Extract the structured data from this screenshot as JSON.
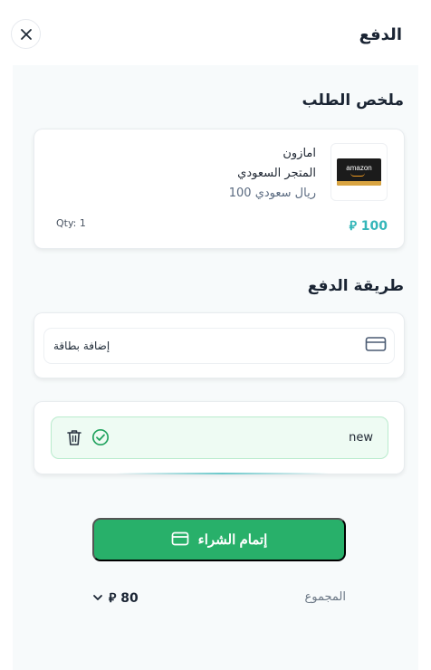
{
  "header": {
    "title": "الدفع"
  },
  "order_summary": {
    "title": "ملخص الطلب",
    "item": {
      "brand": "امازون",
      "store": "المتجر السعودي",
      "denomination": "ريال سعودي 100",
      "thumbnail_text": "amazon",
      "quantity": "Qty: 1",
      "price": "100 ⃁"
    }
  },
  "payment_method": {
    "title": "طريقة الدفع",
    "add_card_label": "إضافة بطاقة",
    "saved_method": {
      "name": "new"
    }
  },
  "checkout": {
    "button_label": "إتمام الشراء",
    "total_label": "المجموع",
    "total_value": "80 ⃁"
  },
  "colors": {
    "primary_green": "#28b06a",
    "price_teal": "#35b6b9",
    "method_bg": "#eefbf3",
    "method_border": "#b9ebcd"
  },
  "icons": [
    "close-icon",
    "credit-card-icon",
    "trash-icon",
    "check-circle-icon",
    "chevron-down-icon",
    "riyal-icon"
  ]
}
